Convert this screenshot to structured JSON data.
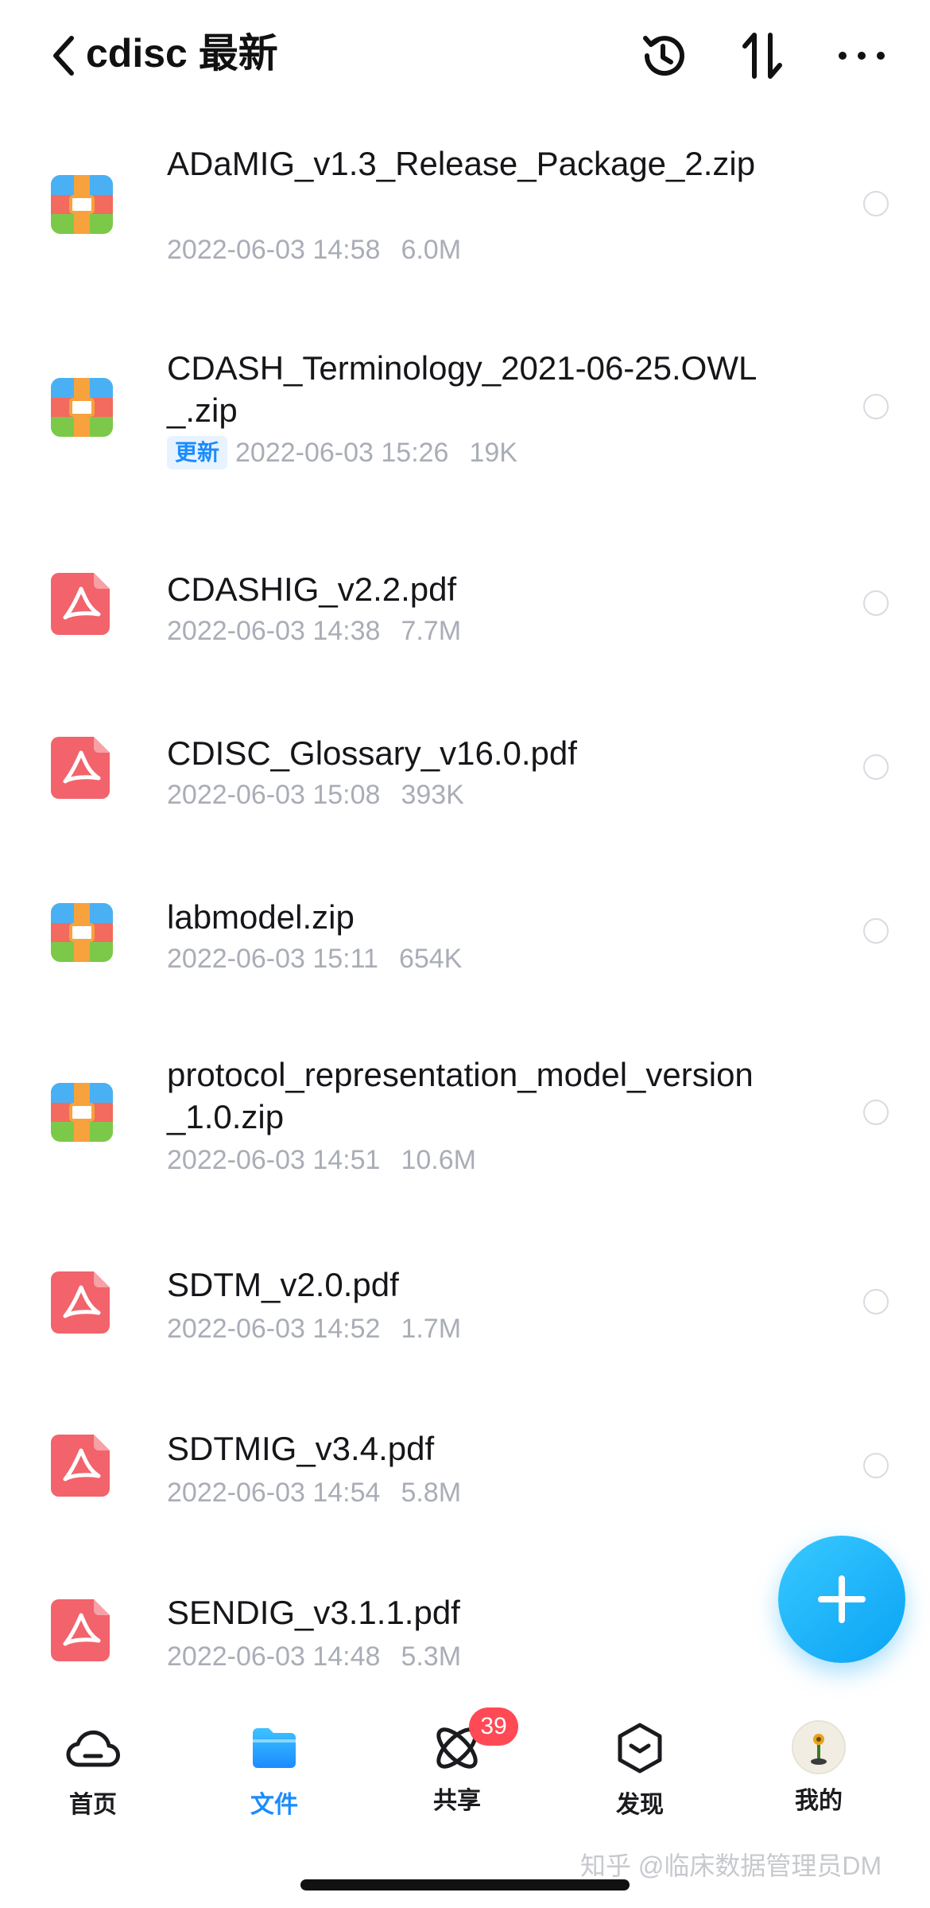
{
  "header": {
    "title": "cdisc 最新",
    "back_icon": "chevron-left-icon",
    "history_icon": "history-icon",
    "sort_icon": "sort-icon",
    "more_icon": "more-dots-icon"
  },
  "files": [
    {
      "name": "ADaMIG_v1.3_Release_Package_2.zip",
      "type": "zip",
      "date": "2022-06-03 14:58",
      "size": "6.0M",
      "badge": ""
    },
    {
      "name": "CDASH_Terminology_2021-06-25.OWL_.zip",
      "type": "zip",
      "date": "2022-06-03 15:26",
      "size": "19K",
      "badge": "更新"
    },
    {
      "name": "CDASHIG_v2.2.pdf",
      "type": "pdf",
      "date": "2022-06-03 14:38",
      "size": "7.7M",
      "badge": ""
    },
    {
      "name": "CDISC_Glossary_v16.0.pdf",
      "type": "pdf",
      "date": "2022-06-03 15:08",
      "size": "393K",
      "badge": ""
    },
    {
      "name": "labmodel.zip",
      "type": "zip",
      "date": "2022-06-03 15:11",
      "size": "654K",
      "badge": ""
    },
    {
      "name": "protocol_representation_model_version_1.0.zip",
      "type": "zip",
      "date": "2022-06-03 14:51",
      "size": "10.6M",
      "badge": ""
    },
    {
      "name": "SDTM_v2.0.pdf",
      "type": "pdf",
      "date": "2022-06-03 14:52",
      "size": "1.7M",
      "badge": ""
    },
    {
      "name": "SDTMIG_v3.4.pdf",
      "type": "pdf",
      "date": "2022-06-03 14:54",
      "size": "5.8M",
      "badge": ""
    },
    {
      "name": "SENDIG_v3.1.1.pdf",
      "type": "pdf",
      "date": "2022-06-03 14:48",
      "size": "5.3M",
      "badge": ""
    }
  ],
  "fab": {
    "icon": "plus-icon"
  },
  "tabs": [
    {
      "label": "首页",
      "icon": "cloud-icon",
      "active": false
    },
    {
      "label": "文件",
      "icon": "folder-icon",
      "active": true
    },
    {
      "label": "共享",
      "icon": "atom-share-icon",
      "active": false,
      "badge": "39"
    },
    {
      "label": "发现",
      "icon": "cube-icon",
      "active": false
    },
    {
      "label": "我的",
      "icon": "avatar-icon",
      "active": false
    }
  ],
  "watermark": "知乎 @临床数据管理员DM",
  "colors": {
    "accent": "#1a8cff",
    "badge_red": "#ff4a55",
    "pdf_red": "#f2636b",
    "meta_gray": "#a9adb6"
  }
}
